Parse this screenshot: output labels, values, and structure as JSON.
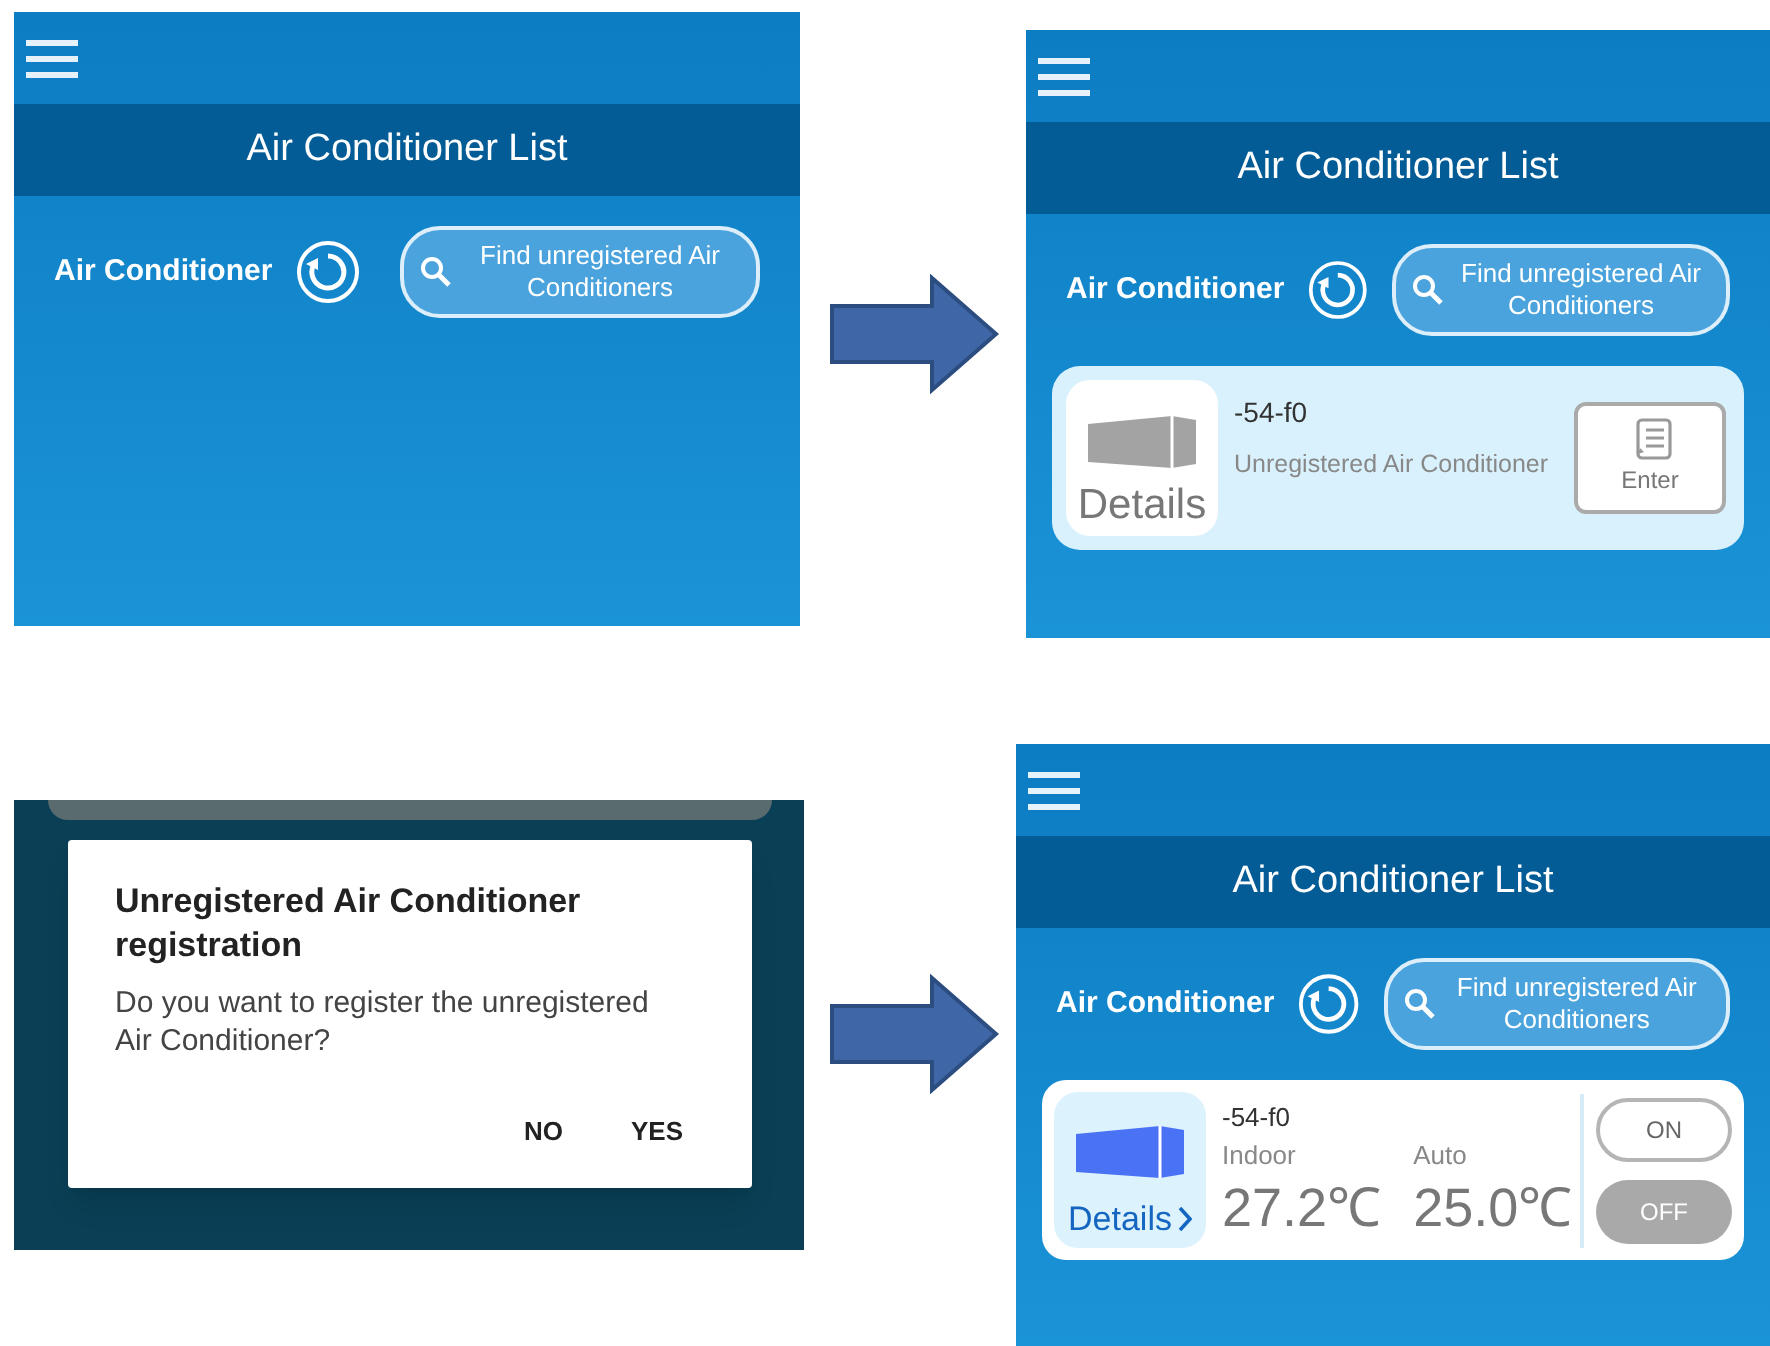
{
  "panels": [
    {
      "kind": "list",
      "title": "Air Conditioner List",
      "section_label": "Air Conditioner",
      "find_button": "Find unregistered Air Conditioners"
    },
    {
      "kind": "list",
      "title": "Air Conditioner List",
      "section_label": "Air Conditioner",
      "find_button": "Find unregistered Air Conditioners",
      "devices": [
        {
          "kind": "unregistered",
          "name": "-54-f0",
          "details": "Details",
          "status": "Unregistered Air Conditioner",
          "enter_button": "Enter"
        }
      ]
    },
    {
      "kind": "dialog",
      "title": "Unregistered Air Conditioner registration",
      "message": "Do you want to register the unregistered Air Conditioner?",
      "buttons": [
        "NO",
        "YES"
      ]
    },
    {
      "kind": "list",
      "title": "Air Conditioner List",
      "section_label": "Air Conditioner",
      "find_button": "Find unregistered Air Conditioners",
      "devices": [
        {
          "kind": "registered",
          "name": "-54-f0",
          "details": "Details",
          "indoor_label": "Indoor",
          "indoor_temp": "27.2℃",
          "mode_label": "Auto",
          "set_temp": "25.0℃",
          "power": [
            {
              "label": "ON",
              "selected": false
            },
            {
              "label": "OFF",
              "selected": true
            }
          ]
        }
      ]
    }
  ]
}
